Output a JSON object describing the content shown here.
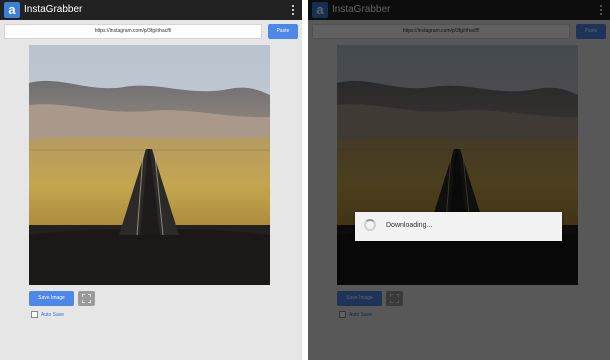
{
  "app": {
    "icon_letter": "a",
    "title": "InstaGrabber",
    "overflow_icon": "more-vert-icon"
  },
  "url_input": {
    "value": "https://instagram.com/p/3fg/rihacff/"
  },
  "buttons": {
    "paste": "Paste",
    "save_image": "Save Image",
    "fullscreen_icon": "fullscreen-icon"
  },
  "autosave": {
    "label": "Auto Save",
    "checked": false
  },
  "dialog": {
    "message": "Downloading..."
  },
  "colors": {
    "appbar": "#222222",
    "accent": "#4d87e8",
    "background": "#e6e6e6"
  }
}
